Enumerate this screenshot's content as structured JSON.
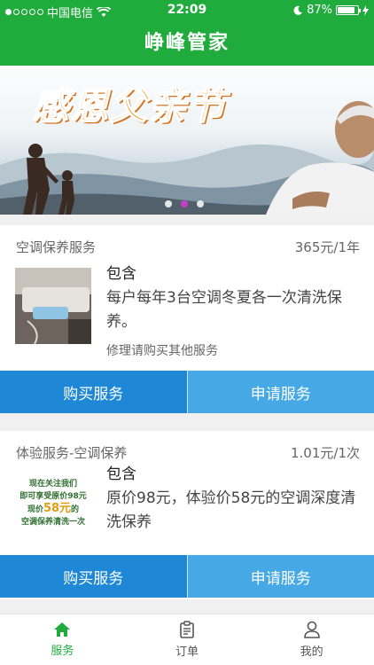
{
  "status_bar": {
    "carrier": "中国电信",
    "time": "22:09",
    "battery": "87%",
    "battery_level": 0.87
  },
  "header": {
    "title": "峥峰管家"
  },
  "banner": {
    "title": "感恩父亲节",
    "page_count": 3,
    "active_page": 2
  },
  "cards": [
    {
      "title": "空调保养服务",
      "price": "365元/1年",
      "include_label": "包含",
      "description": "每户每年3台空调冬夏各一次清洗保养。",
      "note": "修理请购买其他服务",
      "buy_label": "购买服务",
      "apply_label": "申请服务"
    },
    {
      "title": "体验服务-空调保养",
      "price": "1.01元/1次",
      "include_label": "包含",
      "description": "原价98元，体验价58元的空调深度清洗保养",
      "promo": {
        "line1": "现在关注我们",
        "line2": "即可享受原价98元",
        "line3a": "现价",
        "line3b": "58元",
        "line3c": "的",
        "line4": "空调保养清洗一次"
      },
      "buy_label": "购买服务",
      "apply_label": "申请服务"
    }
  ],
  "tabbar": {
    "items": [
      {
        "label": "服务",
        "icon": "home-icon",
        "active": true
      },
      {
        "label": "订单",
        "icon": "clipboard-icon",
        "active": false
      },
      {
        "label": "我的",
        "icon": "person-icon",
        "active": false
      }
    ]
  },
  "colors": {
    "brand_green": "#1fac3c",
    "buy_blue": "#1e88d6",
    "apply_blue": "#46a9e6",
    "indicator_active": "#c83cc8"
  }
}
